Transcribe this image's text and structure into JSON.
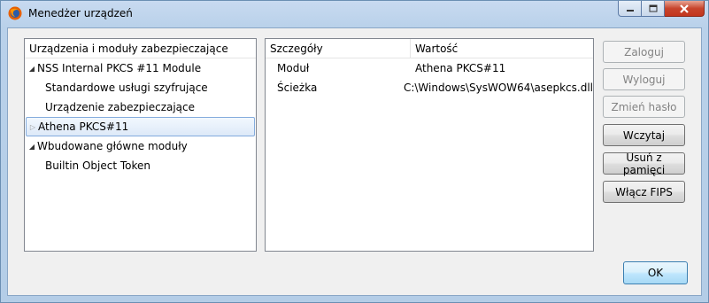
{
  "window": {
    "title": "Menedżer urządzeń"
  },
  "tree": {
    "header": "Urządzenia i moduły zabezpieczające",
    "items": [
      {
        "label": "NSS Internal PKCS #11 Module",
        "level": 0,
        "expanded": true
      },
      {
        "label": "Standardowe usługi szyfrujące",
        "level": 1
      },
      {
        "label": "Urządzenie zabezpieczające",
        "level": 1
      },
      {
        "label": "Athena PKCS#11",
        "level": 0,
        "expanded": false,
        "selected": true
      },
      {
        "label": "Wbudowane główne moduły",
        "level": 0,
        "expanded": true
      },
      {
        "label": "Builtin Object Token",
        "level": 1
      }
    ]
  },
  "details": {
    "columns": [
      "Szczegóły",
      "Wartość"
    ],
    "rows": [
      {
        "key": "Moduł",
        "value": "Athena PKCS#11"
      },
      {
        "key": "Ścieżka",
        "value": "C:\\Windows\\SysWOW64\\asepkcs.dll"
      }
    ]
  },
  "buttons": {
    "login": "Zaloguj",
    "logout": "Wyloguj",
    "change_password": "Zmień hasło",
    "load": "Wczytaj",
    "unload": "Usuń z pamięci",
    "enable_fips": "Włącz FIPS",
    "ok": "OK"
  },
  "colors": {
    "selection_border": "#84acdd",
    "ok_border": "#3c7fb1",
    "close_button": "#c7452d"
  }
}
